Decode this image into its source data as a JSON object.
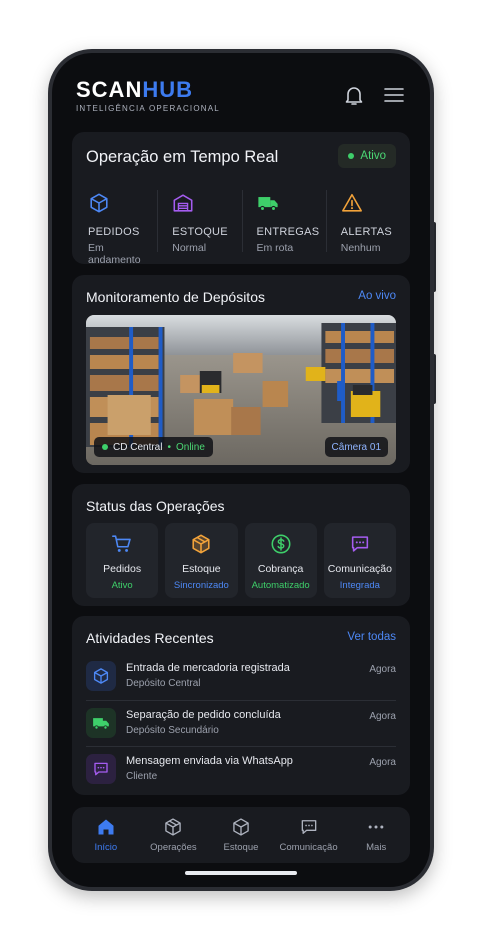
{
  "header": {
    "logo_scan": "SCAN",
    "logo_hub": "HUB",
    "tagline": "INTELIGÊNCIA OPERACIONAL",
    "bell_icon": "bell-icon",
    "menu_icon": "hamburger-menu-icon"
  },
  "realtime": {
    "title": "Operação em Tempo Real",
    "status": "Ativo",
    "stats": [
      {
        "icon": "cube-icon",
        "label": "PEDIDOS",
        "sub": "Em andamento",
        "color": "#4d88f5"
      },
      {
        "icon": "warehouse-icon",
        "label": "ESTOQUE",
        "sub": "Normal",
        "color": "#a55cf0"
      },
      {
        "icon": "truck-icon",
        "label": "ENTREGAS",
        "sub": "Em rota",
        "color": "#3ecf6a"
      },
      {
        "icon": "warning-icon",
        "label": "ALERTAS",
        "sub": "Nenhum",
        "color": "#f2a33a"
      }
    ]
  },
  "monitoring": {
    "title": "Monitoramento de Depósitos",
    "live_link": "Ao vivo",
    "location": "CD Central",
    "status": "Online",
    "camera": "Câmera 01"
  },
  "operations": {
    "title": "Status das Operações",
    "items": [
      {
        "icon": "cart-icon",
        "name": "Pedidos",
        "status": "Ativo",
        "color": "#4d88f5",
        "status_color": "#3ecf6a"
      },
      {
        "icon": "box-icon",
        "name": "Estoque",
        "status": "Sincronizado",
        "color": "#f2a33a",
        "status_color": "#4d88f5"
      },
      {
        "icon": "dollar-icon",
        "name": "Cobrança",
        "status": "Automatizado",
        "color": "#3ecf6a",
        "status_color": "#3ecf6a"
      },
      {
        "icon": "chat-icon",
        "name": "Comunicação",
        "status": "Integrada",
        "color": "#a55cf0",
        "status_color": "#4d88f5"
      }
    ]
  },
  "activities": {
    "title": "Atividades Recentes",
    "see_all": "Ver todas",
    "items": [
      {
        "icon": "cube-icon",
        "title": "Entrada de mercadoria registrada",
        "sub": "Depósito Central",
        "time": "Agora",
        "color": "#4d88f5",
        "bg": "#1f2a44"
      },
      {
        "icon": "truck-icon",
        "title": "Separação de pedido concluída",
        "sub": "Depósito Secundário",
        "time": "Agora",
        "color": "#3ecf6a",
        "bg": "#1d3326"
      },
      {
        "icon": "chat-icon",
        "title": "Mensagem enviada via WhatsApp",
        "sub": "Cliente",
        "time": "Agora",
        "color": "#a55cf0",
        "bg": "#2c2140"
      }
    ]
  },
  "nav": {
    "items": [
      {
        "icon": "home-icon",
        "label": "Início",
        "active": true
      },
      {
        "icon": "box-icon",
        "label": "Operações",
        "active": false
      },
      {
        "icon": "box-icon",
        "label": "Estoque",
        "active": false
      },
      {
        "icon": "chat-icon",
        "label": "Comunicação",
        "active": false
      },
      {
        "icon": "more-icon",
        "label": "Mais",
        "active": false
      }
    ]
  },
  "colors": {
    "accent": "#3d7bf0",
    "success": "#3ecf6a",
    "background": "#0c0d10",
    "card": "#191b20"
  }
}
